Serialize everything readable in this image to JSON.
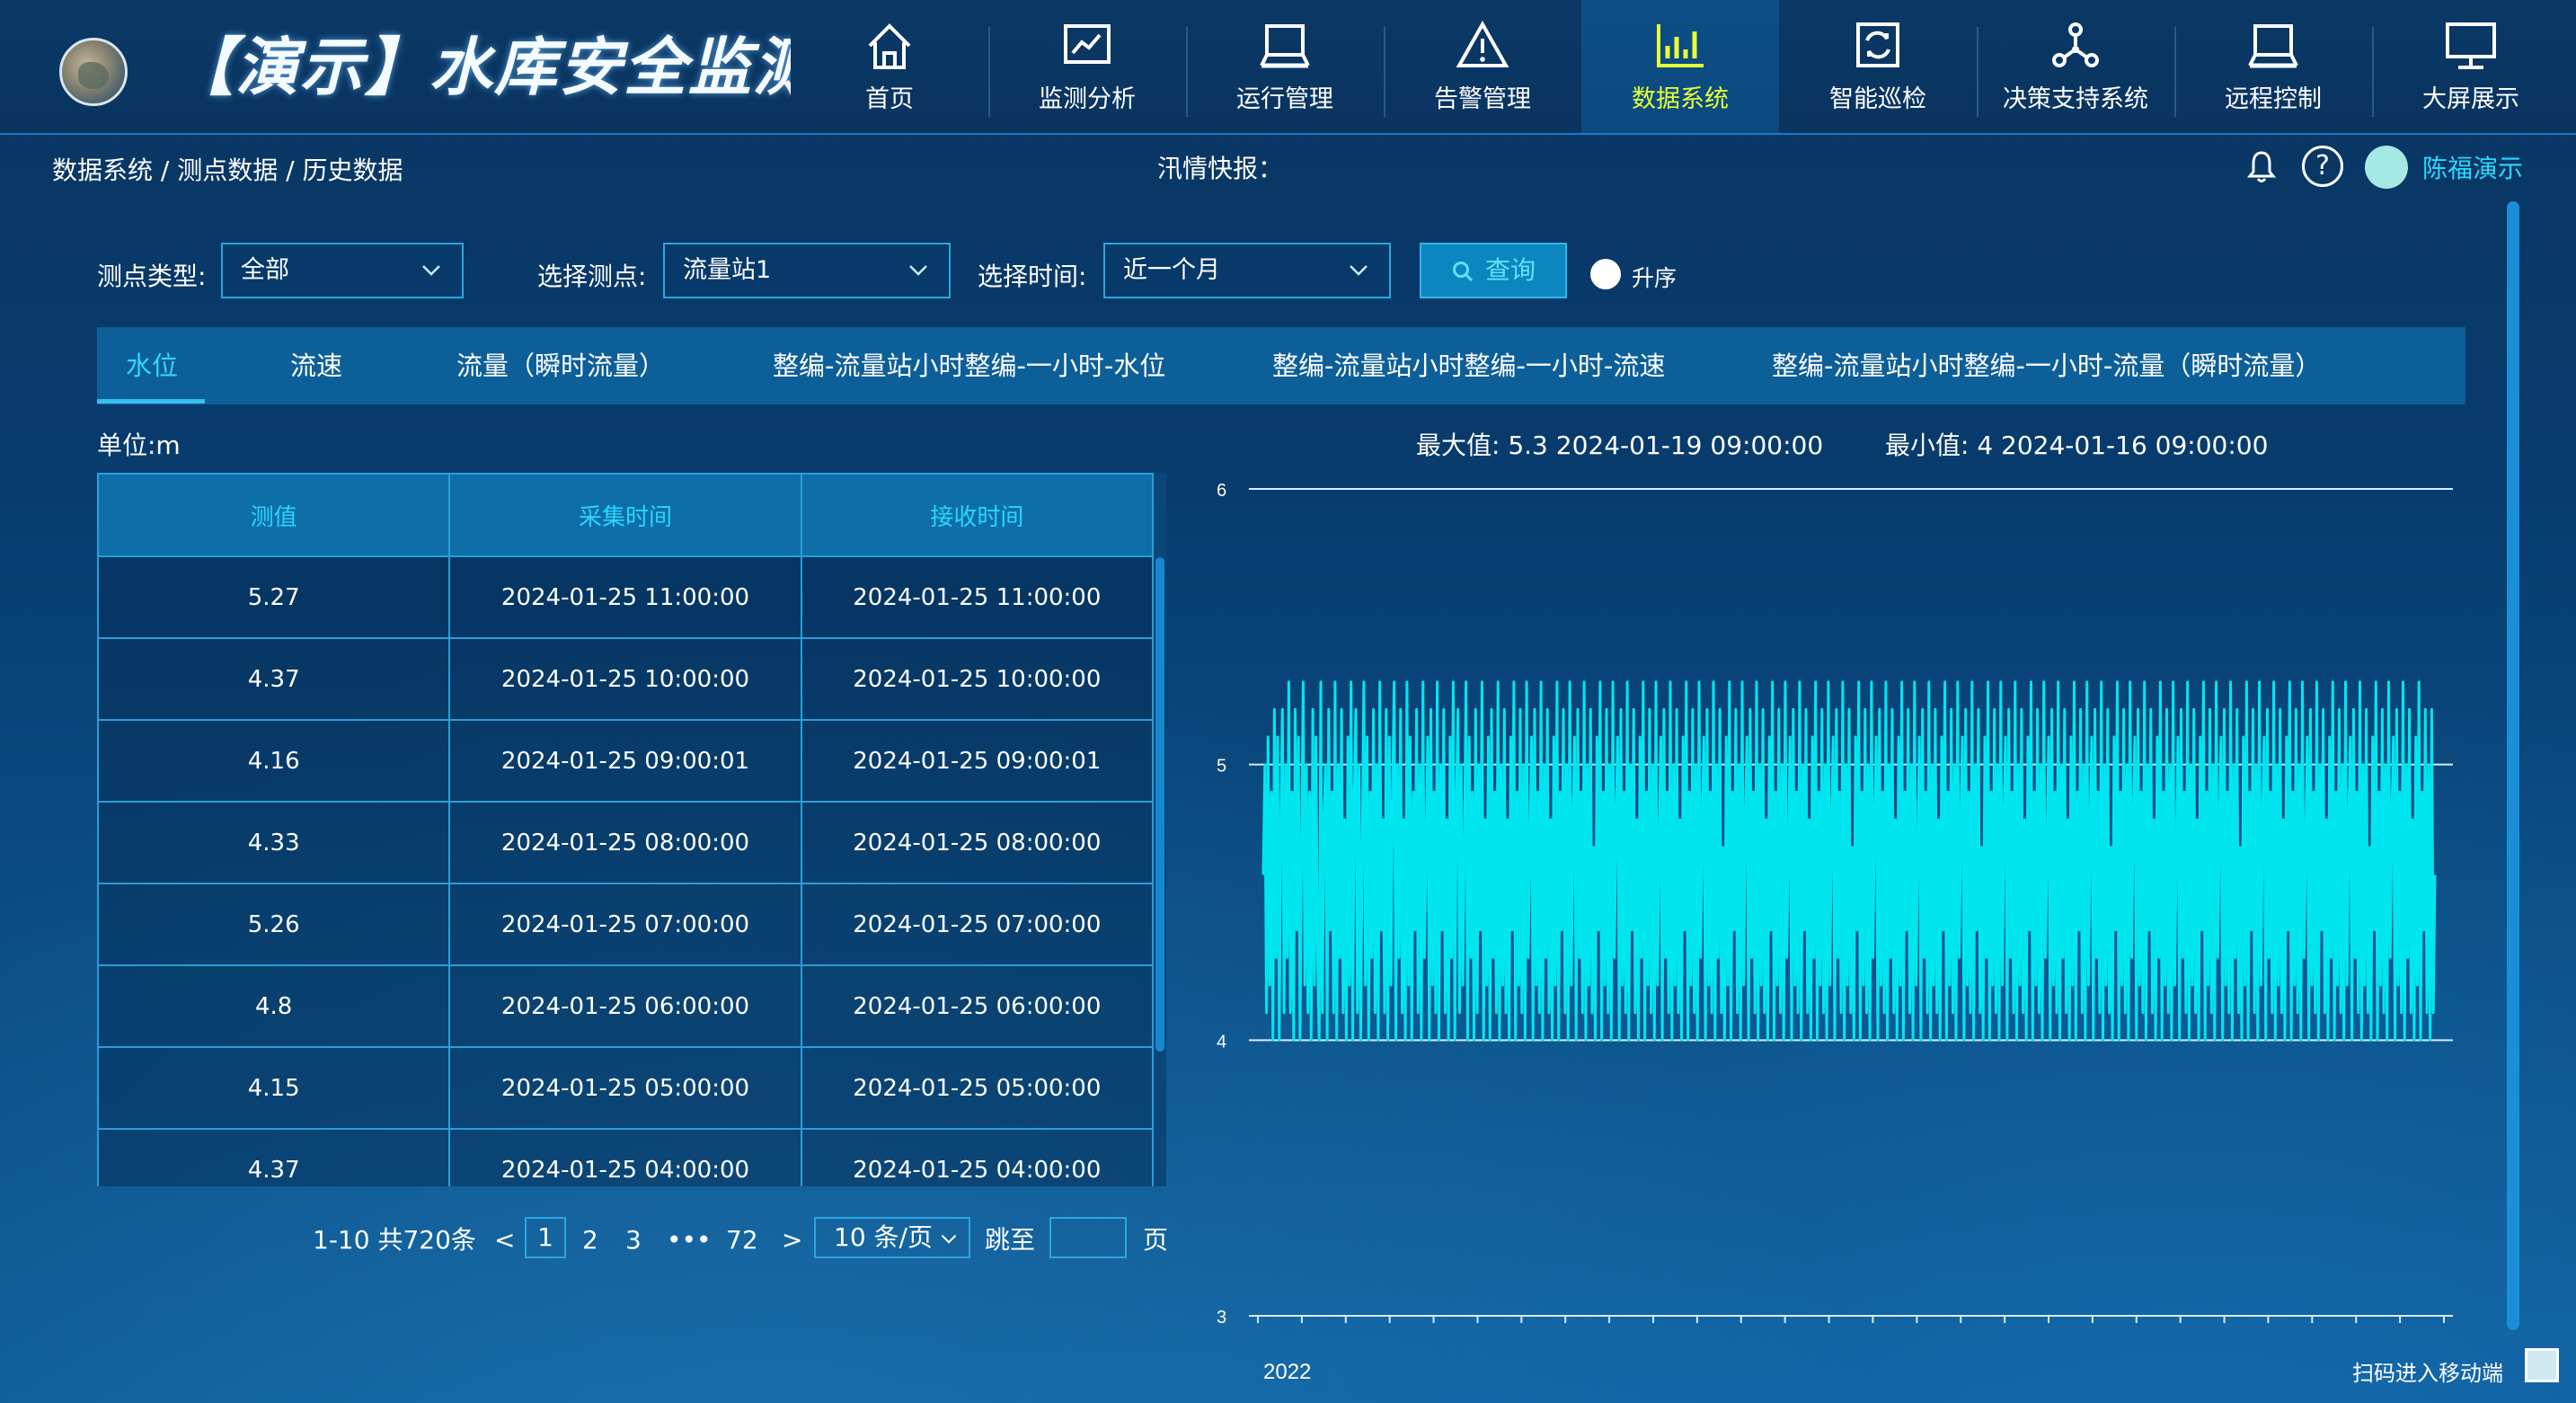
{
  "app": {
    "title": "【演示】水库安全监测系统"
  },
  "nav": [
    {
      "label": "首页",
      "icon": "home-icon"
    },
    {
      "label": "监测分析",
      "icon": "line-chart-icon"
    },
    {
      "label": "运行管理",
      "icon": "laptop-icon"
    },
    {
      "label": "告警管理",
      "icon": "warning-icon"
    },
    {
      "label": "数据系统",
      "icon": "bar-chart-icon",
      "active": true
    },
    {
      "label": "智能巡检",
      "icon": "refresh-screen-icon"
    },
    {
      "label": "决策支持系统",
      "icon": "network-nodes-icon"
    },
    {
      "label": "远程控制",
      "icon": "laptop-icon"
    },
    {
      "label": "大屏展示",
      "icon": "monitor-icon"
    }
  ],
  "breadcrumb": "数据系统 / 测点数据 / 历史数据",
  "flash_label": "汛情快报：",
  "user": {
    "name": "陈福演示"
  },
  "filters": {
    "type_label": "测点类型:",
    "type_value": "全部",
    "point_label": "选择测点:",
    "point_value": "流量站1",
    "time_label": "选择时间:",
    "time_value": "近一个月",
    "query_label": "查询",
    "sort_label": "升序"
  },
  "tabs": [
    "水位",
    "流速",
    "流量（瞬时流量）",
    "整编-流量站小时整编-一小时-水位",
    "整编-流量站小时整编-一小时-流速",
    "整编-流量站小时整编-一小时-流量（瞬时流量）"
  ],
  "unit": "单位:m",
  "stats": {
    "max": "最大值: 5.3 2024-01-19 09:00:00",
    "min": "最小值: 4 2024-01-16 09:00:00"
  },
  "table": {
    "headers": [
      "测值",
      "采集时间",
      "接收时间"
    ],
    "rows": [
      [
        "5.27",
        "2024-01-25 11:00:00",
        "2024-01-25 11:00:00"
      ],
      [
        "4.37",
        "2024-01-25 10:00:00",
        "2024-01-25 10:00:00"
      ],
      [
        "4.16",
        "2024-01-25 09:00:01",
        "2024-01-25 09:00:01"
      ],
      [
        "4.33",
        "2024-01-25 08:00:00",
        "2024-01-25 08:00:00"
      ],
      [
        "5.26",
        "2024-01-25 07:00:00",
        "2024-01-25 07:00:00"
      ],
      [
        "4.8",
        "2024-01-25 06:00:00",
        "2024-01-25 06:00:00"
      ],
      [
        "4.15",
        "2024-01-25 05:00:00",
        "2024-01-25 05:00:00"
      ],
      [
        "4.37",
        "2024-01-25 04:00:00",
        "2024-01-25 04:00:00"
      ]
    ]
  },
  "pagination": {
    "total": "1-10 共720条",
    "prev": "<",
    "pages": [
      "1",
      "2",
      "3",
      "•••",
      "72"
    ],
    "next": ">",
    "page_size": "10 条/页",
    "jump_label": "跳至",
    "page_unit": "页"
  },
  "chart_data": {
    "type": "line",
    "xlabel": "",
    "ylabel": "",
    "x_tick_label": "2022",
    "ylim": [
      3,
      6
    ],
    "yticks": [
      3,
      4,
      5,
      6
    ],
    "color": "#00e6f0",
    "series": [
      {
        "values": [
          4.6,
          5.0,
          4.1,
          5.1,
          4.2,
          4.9,
          4.0,
          5.2,
          4.3,
          5.1,
          4.0,
          4.8,
          5.2,
          4.1,
          5.0,
          4.3,
          5.3,
          4.1,
          4.9,
          4.0,
          5.2,
          4.4,
          5.1,
          4.0,
          4.7,
          5.3,
          4.2,
          5.0,
          4.1,
          4.9,
          4.0,
          5.2,
          4.2,
          5.1,
          4.3,
          4.0,
          5.3,
          4.1,
          4.8,
          5.0,
          4.0,
          5.2,
          4.4,
          4.9,
          4.1,
          5.3,
          4.0,
          5.0,
          4.3,
          5.2,
          4.1,
          4.8,
          4.0,
          5.1,
          4.2,
          5.3,
          4.0,
          4.9,
          5.2,
          4.1,
          5.0,
          4.0,
          4.7,
          5.3,
          4.2,
          5.1,
          4.0,
          4.9,
          4.3,
          5.2,
          4.1,
          5.0,
          4.0,
          5.3,
          4.4,
          4.8,
          4.1,
          5.2,
          4.0,
          5.1,
          4.2,
          4.9,
          5.3,
          4.0,
          5.0,
          4.3,
          5.2,
          4.1,
          4.8,
          4.0,
          5.3,
          4.2,
          5.1,
          4.0,
          4.9,
          4.4,
          5.2,
          4.1,
          5.0,
          4.0,
          5.3,
          4.3,
          4.7,
          5.1,
          4.0,
          5.2,
          4.2,
          4.9,
          4.1,
          5.3,
          4.0,
          5.0,
          4.4,
          5.2,
          4.1,
          4.8,
          4.0,
          5.1,
          4.3,
          5.3,
          4.0,
          4.9,
          5.2,
          4.1,
          5.0,
          4.2,
          4.7,
          5.3,
          4.0,
          5.1,
          4.3,
          4.9,
          4.0,
          5.2,
          4.1,
          5.0,
          4.4,
          5.3,
          4.0,
          4.8,
          4.2,
          5.1,
          4.0,
          5.2,
          4.3,
          4.9,
          4.1,
          5.3,
          4.0,
          5.0,
          4.2,
          5.2,
          4.1,
          4.8,
          4.0,
          5.1,
          4.4,
          5.3,
          4.0,
          4.9,
          4.2,
          5.2,
          4.1,
          5.0,
          4.0,
          5.3,
          4.3,
          4.7,
          5.1,
          4.0,
          5.2,
          4.2,
          4.9,
          4.1,
          5.3,
          4.0,
          5.0,
          4.3,
          5.2,
          4.1,
          4.8,
          4.0,
          5.1,
          4.2,
          5.3,
          4.0,
          4.9,
          4.4,
          5.2,
          4.1,
          5.0,
          4.0,
          5.3,
          4.2,
          4.8,
          5.1,
          4.0,
          5.2,
          4.3,
          4.9,
          4.1,
          5.3,
          4.0,
          5.0,
          4.2,
          5.2,
          4.1,
          4.7,
          4.0,
          5.1,
          4.4,
          5.3,
          4.0,
          4.9,
          4.2,
          5.2,
          4.1,
          5.0,
          4.0,
          5.3,
          4.3,
          4.8,
          5.1,
          4.0,
          5.2,
          4.2,
          4.9,
          4.1,
          5.3,
          4.0,
          5.0,
          4.4,
          5.2,
          4.1,
          4.8,
          4.0,
          5.1,
          4.3,
          5.3,
          4.0,
          4.9,
          4.2,
          5.2,
          4.1,
          5.0,
          4.0,
          5.3,
          4.2,
          4.7,
          5.1,
          4.0,
          5.2,
          4.3,
          4.9,
          4.1,
          5.3,
          4.0,
          5.0,
          4.2,
          5.2,
          4.1,
          4.8,
          4.0,
          5.1,
          4.4,
          5.3,
          4.0,
          4.9,
          4.2,
          5.2,
          4.1,
          5.0,
          4.0,
          5.3,
          4.3,
          4.8,
          5.1,
          4.0,
          5.2,
          4.2,
          4.9,
          4.1,
          5.3,
          4.0,
          5.0,
          4.3,
          5.2,
          4.1,
          4.7,
          4.0,
          5.1,
          4.2,
          5.3,
          4.0,
          4.9,
          4.4,
          5.2,
          4.1,
          5.0,
          4.0,
          5.3,
          4.2,
          4.8,
          5.1,
          4.0,
          5.2,
          4.3,
          4.9,
          4.1,
          5.3,
          4.0,
          5.0,
          4.2,
          5.2,
          4.1,
          4.8,
          4.0,
          5.1,
          4.4,
          5.3,
          4.0,
          4.9,
          4.2,
          5.2,
          4.1,
          5.0,
          4.0,
          5.3,
          4.3,
          4.7,
          5.1,
          4.0,
          5.2,
          4.2,
          4.9,
          4.1,
          5.3,
          4.0,
          5.0,
          4.4,
          5.2,
          4.1,
          4.8,
          4.0,
          5.1,
          4.3,
          5.3,
          4.0,
          4.9,
          4.2,
          5.2,
          4.1,
          5.0,
          4.0,
          5.3,
          4.2,
          4.8,
          5.1,
          4.0,
          5.2,
          4.3,
          4.9,
          4.1,
          5.3,
          4.0,
          5.0,
          4.2,
          5.2,
          4.1,
          4.7,
          4.0,
          5.1,
          4.4,
          5.3,
          4.0,
          4.9,
          4.2,
          5.2,
          4.1,
          5.0,
          4.0,
          5.3,
          4.3,
          4.8,
          5.1,
          4.0,
          5.2,
          4.2,
          4.9,
          4.1,
          5.3,
          4.0,
          5.0,
          4.3,
          5.2,
          4.1,
          4.8,
          4.0,
          5.1,
          4.2,
          5.3,
          4.0,
          4.9,
          4.4,
          5.2,
          4.1,
          5.0,
          4.0,
          5.3,
          4.2,
          4.7,
          5.1,
          4.0,
          5.2,
          4.3,
          4.9,
          4.1,
          5.3,
          4.0,
          5.0,
          4.2,
          5.2,
          4.1,
          4.8,
          4.0,
          5.1,
          4.4,
          5.3,
          4.0,
          4.9,
          4.2,
          5.2,
          4.1,
          5.0,
          4.0,
          5.3,
          4.3,
          4.8,
          5.1,
          4.0,
          5.2,
          4.2,
          4.9,
          4.1,
          5.3,
          4.0,
          5.0,
          4.4,
          5.2,
          4.1,
          4.7,
          4.0,
          5.1,
          4.3,
          5.3,
          4.0,
          4.9,
          4.2,
          5.2,
          4.1,
          5.0,
          4.0,
          5.3,
          4.2,
          4.8,
          5.1,
          4.0,
          5.2,
          4.3,
          4.9,
          4.1,
          5.3,
          4.0,
          5.0,
          4.2,
          5.2,
          4.1,
          4.8,
          4.0,
          5.1,
          4.4,
          5.3,
          4.0,
          4.9,
          4.2,
          5.2,
          4.1,
          5.0,
          4.0,
          5.3,
          4.3,
          4.7,
          5.1,
          4.0,
          5.2,
          4.2,
          4.9,
          4.1,
          5.3,
          4.0,
          5.0,
          4.3,
          5.2,
          4.1,
          4.8,
          4.0,
          5.1,
          4.2,
          5.3,
          4.0,
          4.9,
          4.4,
          5.2,
          4.1,
          5.0,
          4.0,
          5.3,
          4.2,
          4.8,
          5.1,
          4.0,
          5.2,
          4.3,
          4.9,
          4.1,
          5.3,
          4.0,
          5.0,
          4.2,
          5.2,
          4.1,
          4.7,
          4.0,
          5.1,
          4.4,
          5.3,
          4.0,
          4.9,
          4.2,
          5.2,
          4.1,
          5.0,
          4.0,
          5.3,
          4.3,
          4.8,
          5.1,
          4.0,
          5.2,
          4.2,
          4.9,
          4.1,
          5.3,
          4.0,
          5.0,
          4.4,
          5.2,
          4.1,
          4.8,
          4.0,
          5.1,
          4.3,
          5.3,
          4.0,
          4.9,
          4.2,
          5.2,
          4.1,
          5.0,
          4.0,
          5.3,
          4.2,
          4.7,
          5.1,
          4.0,
          5.2,
          4.3,
          4.9,
          4.1,
          5.3,
          4.0,
          5.0,
          4.2,
          5.2,
          4.1,
          4.8,
          4.0,
          5.1,
          4.4,
          5.3,
          4.0,
          4.9,
          4.2,
          5.2,
          4.1,
          5.0,
          4.0,
          5.3,
          4.3,
          4.8,
          5.1,
          4.0,
          5.2,
          4.2,
          4.9,
          4.1,
          5.3,
          4.0,
          5.0,
          4.3,
          5.2,
          4.1,
          4.7,
          4.0,
          5.1,
          4.2,
          5.3,
          4.0,
          4.9,
          4.4,
          5.2,
          4.1,
          5.0,
          4.0,
          5.3,
          4.2,
          4.8,
          5.1,
          4.0,
          5.2,
          4.3,
          4.9,
          4.1,
          5.3,
          4.0,
          5.0,
          4.2,
          5.2,
          4.1,
          4.8,
          4.0,
          5.1,
          4.4,
          5.3,
          4.0,
          4.9,
          4.2,
          5.2,
          4.1,
          5.0,
          4.0,
          5.3,
          4.3,
          4.7,
          5.1,
          4.0,
          5.2,
          4.2,
          4.9,
          4.1,
          5.3,
          4.0,
          5.0,
          4.4,
          5.2,
          4.1,
          4.8,
          4.0,
          5.1,
          4.3,
          5.3,
          4.0,
          4.9,
          4.2,
          5.2,
          4.1,
          5.0,
          4.0,
          5.3,
          4.2,
          4.8,
          5.1,
          4.0,
          5.2,
          4.3,
          4.9,
          4.1,
          5.3,
          4.0,
          5.0,
          4.2,
          5.2,
          4.1,
          4.7,
          4.0,
          5.1,
          4.4,
          5.3,
          4.0,
          4.9,
          4.2,
          5.2,
          4.1,
          5.0,
          4.0,
          5.3,
          4.3,
          4.8,
          5.1,
          4.0,
          5.2,
          4.2,
          4.9,
          4.1,
          5.3,
          4.0,
          5.0,
          4.3,
          5.2,
          4.1,
          4.8,
          4.0,
          5.1,
          4.2,
          5.3,
          4.0,
          4.9,
          4.4,
          5.2,
          4.1,
          5.0,
          4.0,
          5.2,
          4.1,
          4.6
        ]
      }
    ]
  },
  "footer": {
    "mobile_label": "扫码进入移动端"
  }
}
